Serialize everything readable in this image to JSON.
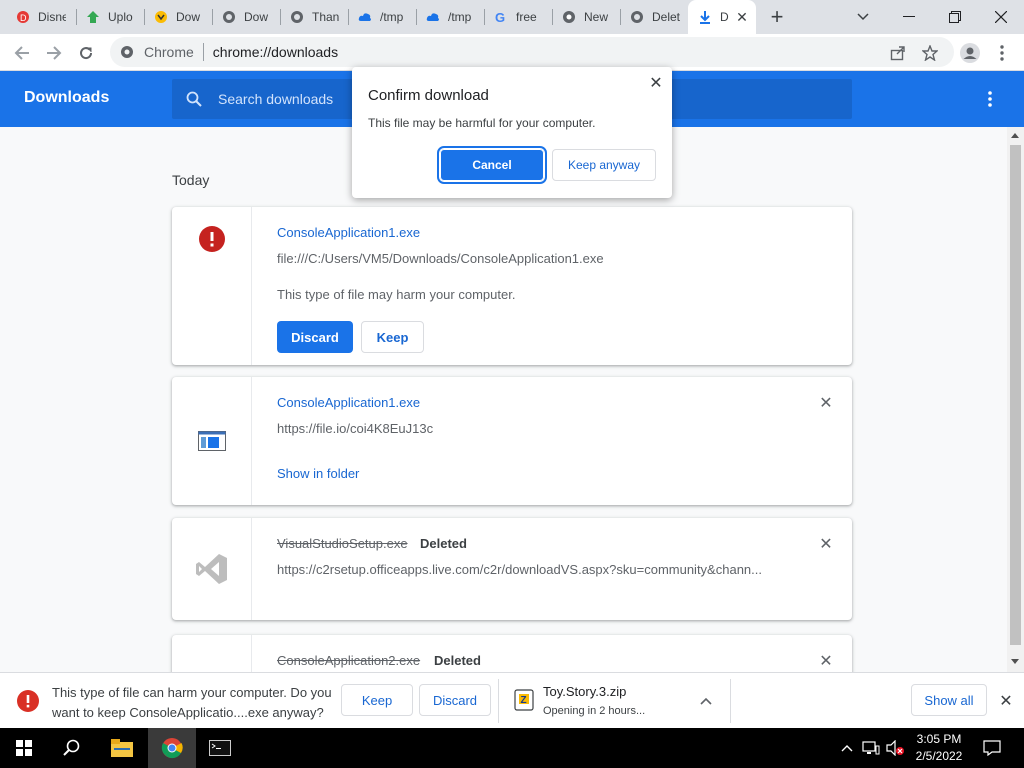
{
  "browser": {
    "tabs": [
      {
        "label": "Disne",
        "icon": "disney-favicon-icon"
      },
      {
        "label": "Uplo",
        "icon": "upload-favicon-icon"
      },
      {
        "label": "Dow",
        "icon": "download-favicon-icon"
      },
      {
        "label": "Dow",
        "icon": "globe-icon"
      },
      {
        "label": "Than",
        "icon": "globe-icon"
      },
      {
        "label": "/tmp",
        "icon": "cloud-icon"
      },
      {
        "label": "/tmp",
        "icon": "cloud-icon"
      },
      {
        "label": "free",
        "icon": "google-icon"
      },
      {
        "label": "New",
        "icon": "chrome-icon"
      },
      {
        "label": "Delet",
        "icon": "globe-icon"
      },
      {
        "label": "D",
        "icon": "download-icon",
        "active": true
      }
    ],
    "omnibox": {
      "chip": "Chrome",
      "url": "chrome://downloads"
    }
  },
  "downloads_page": {
    "title": "Downloads",
    "search_placeholder": "Search downloads",
    "section": "Today",
    "items": [
      {
        "filename": "ConsoleApplication1.exe",
        "url": "file:///C:/Users/VM5/Downloads/ConsoleApplication1.exe",
        "warning": "This type of file may harm your computer.",
        "discard_label": "Discard",
        "keep_label": "Keep"
      },
      {
        "filename": "ConsoleApplication1.exe",
        "url": "https://file.io/coi4K8EuJ13c",
        "action_label": "Show in folder"
      },
      {
        "filename": "VisualStudioSetup.exe",
        "status": "Deleted",
        "url": "https://c2rsetup.officeapps.live.com/c2r/downloadVS.aspx?sku=community&chann..."
      },
      {
        "filename": "ConsoleApplication2.exe",
        "status": "Deleted"
      }
    ]
  },
  "dialog": {
    "title": "Confirm download",
    "message": "This file may be harmful for your computer.",
    "cancel_label": "Cancel",
    "keep_label": "Keep anyway"
  },
  "shelf": {
    "warning_line1": "This type of file can harm your computer. Do you",
    "warning_line2": "want to keep ConsoleApplicatio....exe anyway?",
    "keep_label": "Keep",
    "discard_label": "Discard",
    "zip_name": "Toy.Story.3.zip",
    "zip_status": "Opening in 2 hours...",
    "show_all_label": "Show all"
  },
  "taskbar": {
    "time": "3:05 PM",
    "date": "2/5/2022"
  },
  "colors": {
    "accent": "#1a73e8",
    "header_bg": "#1a73e8",
    "link": "#1967d2",
    "danger": "#d93025"
  }
}
